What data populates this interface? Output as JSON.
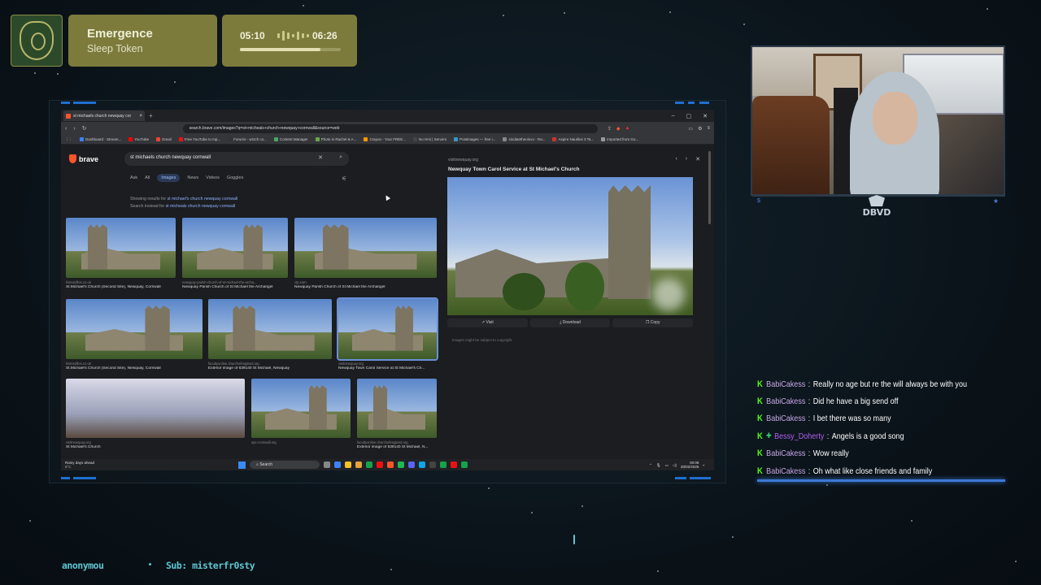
{
  "music": {
    "track": "Emergence",
    "artist": "Sleep Token",
    "current_time": "05:10",
    "total_time": "06:26",
    "progress": 0.8
  },
  "browser": {
    "tab_title": "st michaels church newquay cor",
    "url": "search.brave.com/images?q=st+micheals+church+newquay+cornwall&source=web",
    "bookmarks": [
      "Dashboard · Stream...",
      "YouTube",
      "Gmail",
      "Free YouTube to mp...",
      "Forums - w1tch co...",
      "Content Manager",
      "Photo in Rachel & A...",
      "Crayon - Your FREE...",
      "No Hmi | Servers",
      "Postimages — free i...",
      "sindatetheolovo - Ra...",
      "Aspire Nautilus 3 Ta...",
      "Imported from Go..."
    ]
  },
  "search": {
    "brand": "brave",
    "query": "st michaels church newquay cornwall",
    "tabs": [
      "Ask",
      "All",
      "Images",
      "News",
      "Videos",
      "Goggles"
    ],
    "active_tab": "Images",
    "showing_prefix": "Showing results for",
    "showing_query": "st michael's church newquay cornwall",
    "instead_prefix": "Search instead for",
    "instead_query": "st micheals church newquay cornwall"
  },
  "results": [
    {
      "source": "historyfiles.co.uk",
      "caption": "St.Michael's Church (Second Site), Newquay, Cornwall"
    },
    {
      "source": "newquay-parish-church-of-st-michael-the-archa...",
      "caption": "Newquay Parish Church of St Michael the Archangel"
    },
    {
      "source": "ctp.com",
      "caption": "Newquay Parish Church of St Michael the Archangel"
    },
    {
      "source": "historyfiles.co.uk",
      "caption": "St.Michael's Church (Second Site), Newquay, Cornwall"
    },
    {
      "source": "facultyonline.churchofengland.org",
      "caption": "Exterior image of 639140 St Michael, Newquay"
    },
    {
      "source": "visitnewquay.org",
      "caption": "Newquay Town Carol Service at St Michael's Ch..."
    },
    {
      "source": "visitnewquay.org",
      "caption": "St Michael's Church"
    },
    {
      "source": "opc-cornwall.org",
      "caption": ""
    },
    {
      "source": "facultyonline.churchofengland.org",
      "caption": "Exterior image of 639140 St Michael, N..."
    }
  ],
  "preview": {
    "source": "visitnewquay.org",
    "title": "Newquay Town Carol Service at St Michael's Church",
    "visit": "Visit",
    "download": "Download",
    "copy": "Copy",
    "note": "Images might be subject to copyright"
  },
  "taskbar": {
    "weather_title": "Rainy days ahead",
    "weather_temp": "6°C",
    "search": "Search",
    "time": "00:08",
    "date": "28/02/2026"
  },
  "cam_badge": "DBVD",
  "chat": [
    {
      "user": "BabiCakess",
      "text": "Really no age but re the will always be with you",
      "style": "u1"
    },
    {
      "user": "BabiCakess",
      "text": "Did he have a big send off",
      "style": "u1"
    },
    {
      "user": "BabiCakess",
      "text": "I bet there was so many",
      "style": "u1"
    },
    {
      "user": "Bessy_Doherty",
      "text": "Angels is a good song",
      "style": "u2"
    },
    {
      "user": "BabiCakess",
      "text": "Wow really",
      "style": "u1"
    },
    {
      "user": "BabiCakess",
      "text": "Oh what like close friends and family",
      "style": "u1"
    }
  ],
  "footer": {
    "left": "anonymou",
    "sub": "Sub: misterfr0sty"
  },
  "colors": {
    "accent_blue": "#1f6fd1",
    "music_panel": "#7c7b3c",
    "kick_green": "#53fc18",
    "footer_cyan": "#5fc6d2"
  }
}
